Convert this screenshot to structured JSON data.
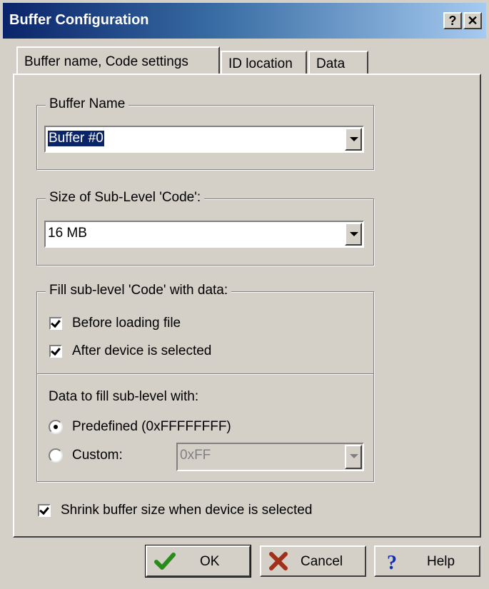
{
  "window": {
    "title": "Buffer Configuration",
    "help_glyph": "?",
    "close_glyph": "✕"
  },
  "tabs": [
    {
      "label": "Buffer name, Code settings",
      "active": true
    },
    {
      "label": "ID location",
      "active": false
    },
    {
      "label": "Data",
      "active": false
    }
  ],
  "buffer_name": {
    "legend": "Buffer Name",
    "value": "Buffer #0"
  },
  "code_size": {
    "legend": "Size of Sub-Level 'Code':",
    "value": "16 MB"
  },
  "fill": {
    "legend": "Fill sub-level 'Code' with data:",
    "before_loading": {
      "label": "Before loading file",
      "checked": true
    },
    "after_selected": {
      "label": "After device is selected",
      "checked": true
    },
    "data_label": "Data to fill sub-level with:",
    "predefined": {
      "label": "Predefined (0xFFFFFFFF)",
      "selected": true
    },
    "custom": {
      "label": "Custom:",
      "selected": false,
      "value": "0xFF"
    }
  },
  "shrink": {
    "label": "Shrink buffer size when device is selected",
    "checked": true
  },
  "buttons": {
    "ok": "OK",
    "cancel": "Cancel",
    "help": "Help"
  },
  "icons": {
    "ok": "checkmark-icon",
    "cancel": "x-cross-icon",
    "help": "question-mark-icon"
  },
  "colors": {
    "title_start": "#0a246a",
    "title_end": "#a6caf0",
    "selection": "#0a246a",
    "ok_icon": "#2a8a1a",
    "cancel_icon": "#a0301a",
    "help_icon": "#1030b0"
  }
}
